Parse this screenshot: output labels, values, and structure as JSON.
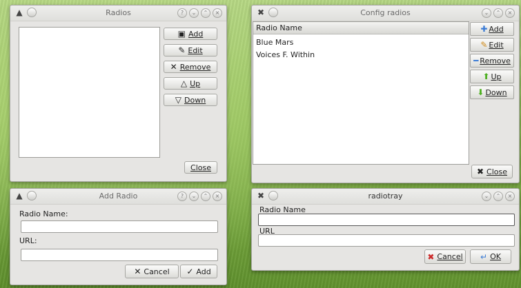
{
  "radios_window": {
    "title": "Radios",
    "buttons": {
      "add": "Add",
      "edit": "Edit",
      "remove": "Remove",
      "up": "Up",
      "down": "Down",
      "close": "Close"
    }
  },
  "config_window": {
    "title": "Config radios",
    "column_header": "Radio Name",
    "rows": [
      "Blue Mars",
      "Voices F. Within"
    ],
    "buttons": {
      "add": "Add",
      "edit": "Edit",
      "remove": "Remove",
      "up": "Up",
      "down": "Down",
      "close": "Close"
    }
  },
  "add_radio_window": {
    "title": "Add Radio",
    "radio_name_label": "Radio Name:",
    "url_label": "URL:",
    "radio_name_value": "",
    "url_value": "",
    "cancel": "Cancel",
    "add": "Add"
  },
  "radiotray_window": {
    "title": "radiotray",
    "radio_name_label": "Radio Name",
    "url_label": "URL",
    "radio_name_value": "",
    "url_value": "",
    "cancel": "Cancel",
    "ok": "OK"
  },
  "colors": {
    "accent_blue": "#3a7bd5",
    "green": "#4caf1f",
    "cancel_red": "#cc2a2a"
  }
}
